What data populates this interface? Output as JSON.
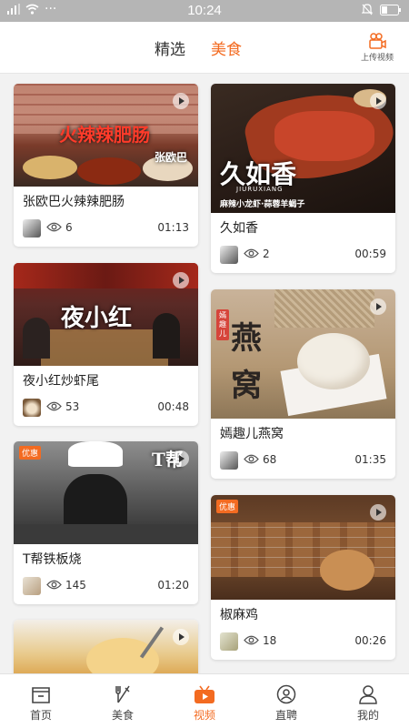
{
  "status_bar": {
    "time": "10:24"
  },
  "header": {
    "tabs": [
      {
        "label": "精选",
        "active": false
      },
      {
        "label": "美食",
        "active": true
      }
    ],
    "upload_label": "上传视频"
  },
  "feed": [
    {
      "title": "张欧巴火辣辣肥肠",
      "views": "6",
      "duration": "01:13",
      "art_text": "火辣辣肥肠",
      "art_sub": "张欧巴"
    },
    {
      "title": "久如香",
      "views": "2",
      "duration": "00:59",
      "art_text": "久如香",
      "art_sub": "JIURUXIANG",
      "art_sub2": "麻辣小龙虾·蒜蓉羊蝎子"
    },
    {
      "title": "夜小红炒虾尾",
      "views": "53",
      "duration": "00:48",
      "art_text": "夜小红"
    },
    {
      "title": "嫣趣儿燕窝",
      "views": "68",
      "duration": "01:35",
      "art_text": "燕窝",
      "art_sub": "嫣趣儿"
    },
    {
      "title": "T帮铁板烧",
      "views": "145",
      "duration": "01:20",
      "art_text": "T帮",
      "art_badge": "优惠"
    },
    {
      "title": "椒麻鸡",
      "views": "18",
      "duration": "00:26",
      "art_badge": "优惠"
    },
    {
      "title": "",
      "views": "",
      "duration": ""
    }
  ],
  "bottom_nav": [
    {
      "label": "首页",
      "icon": "home-icon",
      "active": false
    },
    {
      "label": "美食",
      "icon": "utensils-icon",
      "active": false
    },
    {
      "label": "视频",
      "icon": "video-icon",
      "active": true
    },
    {
      "label": "直聘",
      "icon": "recruit-icon",
      "active": false
    },
    {
      "label": "我的",
      "icon": "profile-icon",
      "active": false
    }
  ],
  "colors": {
    "accent": "#f36b21",
    "status_bar": "#b5b5b5"
  }
}
